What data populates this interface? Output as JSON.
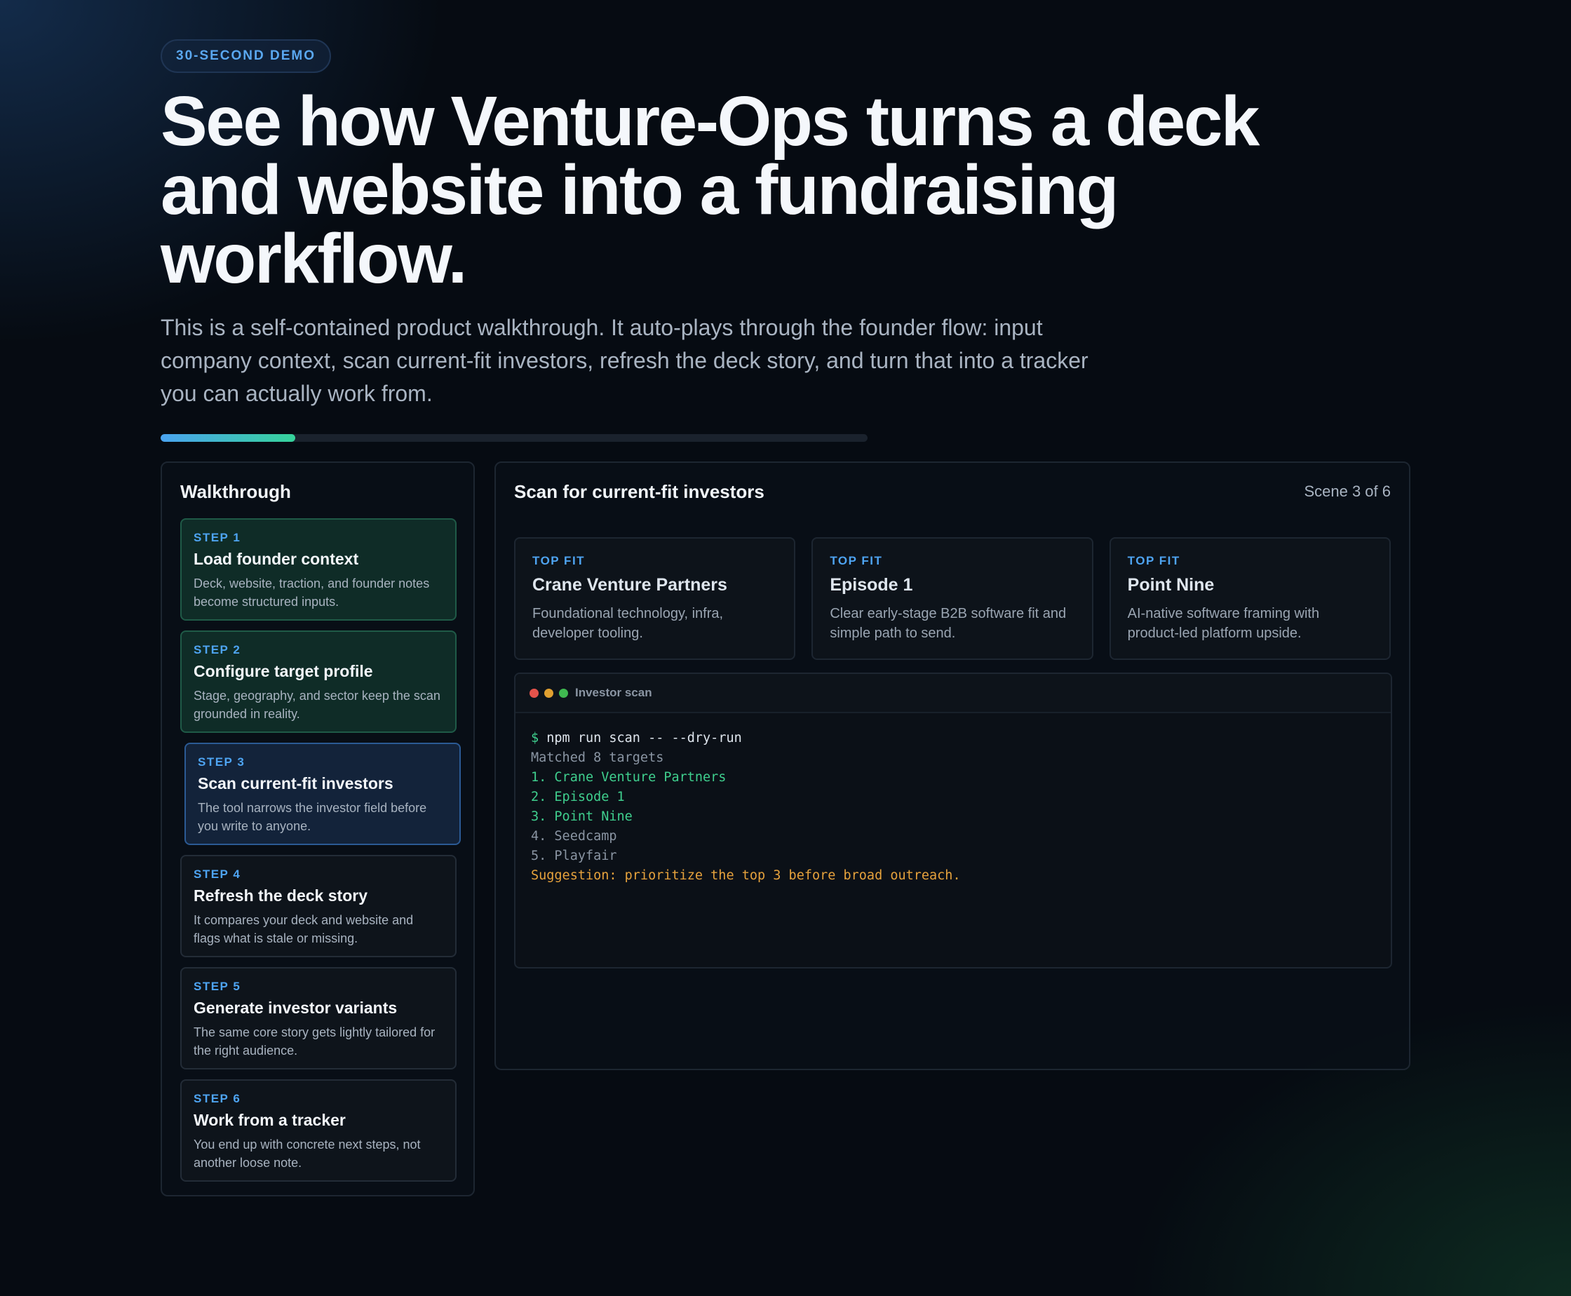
{
  "badge": "30-SECOND DEMO",
  "headline": "See how Venture-Ops turns a deck and website into a fundraising workflow.",
  "lead": "This is a self-contained product walkthrough. It auto-plays through the founder flow: input company context, scan current-fit investors, refresh the deck story, and turn that into a tracker you can actually work from.",
  "progress": {
    "fraction": 0.19,
    "fill_from": "#4aa3f0",
    "fill_to": "#36d39a"
  },
  "sidebar": {
    "title": "Walkthrough",
    "steps": [
      {
        "label": "STEP 1",
        "title": "Load founder context",
        "desc": "Deck, website, traction, and founder notes become structured inputs.",
        "state": "done"
      },
      {
        "label": "STEP 2",
        "title": "Configure target profile",
        "desc": "Stage, geography, and sector keep the scan grounded in reality.",
        "state": "done"
      },
      {
        "label": "STEP 3",
        "title": "Scan current-fit investors",
        "desc": "The tool narrows the investor field before you write to anyone.",
        "state": "active"
      },
      {
        "label": "STEP 4",
        "title": "Refresh the deck story",
        "desc": "It compares your deck and website and flags what is stale or missing.",
        "state": "pending"
      },
      {
        "label": "STEP 5",
        "title": "Generate investor variants",
        "desc": "The same core story gets lightly tailored for the right audience.",
        "state": "pending"
      },
      {
        "label": "STEP 6",
        "title": "Work from a tracker",
        "desc": "You end up with concrete next steps, not another loose note.",
        "state": "pending"
      }
    ]
  },
  "panel": {
    "title": "Scan for current-fit investors",
    "scene": "Scene 3 of 6",
    "cards": [
      {
        "label": "TOP FIT",
        "title": "Crane Venture Partners",
        "desc": "Foundational technology, infra, developer tooling."
      },
      {
        "label": "TOP FIT",
        "title": "Episode 1",
        "desc": "Clear early-stage B2B software fit and simple path to send."
      },
      {
        "label": "TOP FIT",
        "title": "Point Nine",
        "desc": "AI-native software framing with product-led platform upside."
      }
    ],
    "terminal": {
      "title": "Investor scan",
      "dot_colors": [
        "#e5534b",
        "#e0a030",
        "#3fb950"
      ],
      "prompt": "$",
      "command": "npm run scan -- --dry-run",
      "lines": [
        {
          "text": "Matched 8 targets",
          "kind": "dim"
        },
        {
          "text": "1. Crane Venture Partners",
          "kind": "hit"
        },
        {
          "text": "2. Episode 1",
          "kind": "hit"
        },
        {
          "text": "3. Point Nine",
          "kind": "hit"
        },
        {
          "text": "4. Seedcamp",
          "kind": "dim"
        },
        {
          "text": "5. Playfair",
          "kind": "dim"
        },
        {
          "text": "Suggestion: prioritize the top 3 before broad outreach.",
          "kind": "warn"
        }
      ]
    }
  }
}
